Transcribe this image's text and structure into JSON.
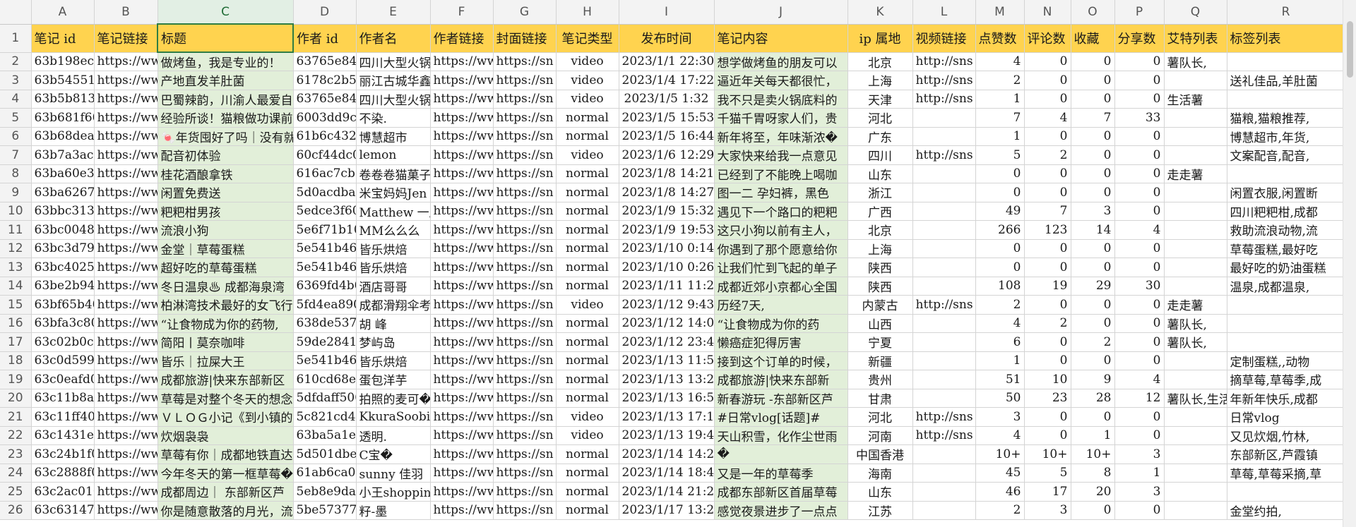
{
  "columns": [
    "A",
    "B",
    "C",
    "D",
    "E",
    "F",
    "G",
    "H",
    "I",
    "J",
    "K",
    "L",
    "M",
    "N",
    "O",
    "P",
    "Q",
    "R"
  ],
  "headers": [
    "笔记 id",
    "笔记链接",
    "标题",
    "作者 id",
    "作者名",
    "作者链接",
    "封面链接",
    "笔记类型",
    "发布时间",
    "笔记内容",
    "ip 属地",
    "视频链接",
    "点赞数",
    "评论数",
    "收藏",
    "分享数",
    "艾特列表",
    "标签列表"
  ],
  "rows": [
    {
      "n": "2",
      "c": [
        "63b198ec00",
        "https://ww",
        "做烤鱼，我是专业的！",
        "63765e8400",
        "四川大型火锅",
        "https://ww",
        "https://sn",
        "video",
        "2023/1/1 22:30",
        "想学做烤鱼的朋友可以",
        "北京",
        "http://sns",
        "4",
        "0",
        "0",
        "0",
        "薯队长,",
        ""
      ]
    },
    {
      "n": "3",
      "c": [
        "63b5455100",
        "https://ww",
        "产地直发羊肚菌",
        "6178c2b500",
        "丽江古城华鑫",
        "https://ww",
        "https://sn",
        "video",
        "2023/1/4 17:22",
        "逼近年关每天都很忙，",
        "上海",
        "http://sns",
        "2",
        "0",
        "0",
        "0",
        "",
        "送礼佳品,羊肚菌"
      ]
    },
    {
      "n": "4",
      "c": [
        "63b5b81300",
        "https://ww",
        "巴蜀辣韵，川渝人最爱自",
        "63765e8400",
        "四川大型火锅",
        "https://ww",
        "https://sn",
        "video",
        "2023/1/5 1:32",
        "我不只是卖火锅底料的",
        "天津",
        "http://sns",
        "1",
        "0",
        "0",
        "0",
        "生活薯",
        ""
      ]
    },
    {
      "n": "5",
      "c": [
        "63b681f600",
        "https://ww",
        "经验所谈！猫粮做功课前",
        "6003dd9c00",
        "不染.",
        "https://ww",
        "https://sn",
        "normal",
        "2023/1/5 15:53",
        "千猫千胃呀家人们，贵",
        "河北",
        "",
        "7",
        "4",
        "7",
        "33",
        "",
        "猫粮,猫粮推荐,"
      ]
    },
    {
      "n": "6",
      "c": [
        "63b68dea00",
        "https://ww",
        "🍬年货囤好了吗｜没有就",
        "61b6c43200",
        "博慧超市",
        "https://ww",
        "https://sn",
        "normal",
        "2023/1/5 16:44",
        "新年将至，年味渐浓�",
        "广东",
        "",
        "1",
        "0",
        "0",
        "0",
        "",
        "博慧超市,年货,"
      ]
    },
    {
      "n": "7",
      "c": [
        "63b7a3ac00",
        "https://ww",
        "配音初体验",
        "60cf44dc00",
        "lemon",
        "https://ww",
        "https://sn",
        "video",
        "2023/1/6 12:29",
        "大家快来给我一点意见",
        "四川",
        "http://sns",
        "5",
        "2",
        "0",
        "0",
        "",
        "文案配音,配音,"
      ]
    },
    {
      "n": "8",
      "c": [
        "63ba60e300",
        "https://ww",
        "桂花酒酿拿铁",
        "616ac7cb00",
        "卷卷卷猫菓子",
        "https://ww",
        "https://sn",
        "normal",
        "2023/1/8 14:21",
        "已经到了不能晚上喝咖",
        "山东",
        "",
        "0",
        "0",
        "0",
        "0",
        "走走薯",
        ""
      ]
    },
    {
      "n": "9",
      "c": [
        "63ba626700",
        "https://ww",
        "闲置免费送",
        "5d0acdba00",
        "米宝妈妈Jen",
        "https://ww",
        "https://sn",
        "normal",
        "2023/1/8 14:27",
        "图一二 孕妇裤，黑色",
        "浙江",
        "",
        "0",
        "0",
        "0",
        "0",
        "",
        "闲置衣服,闲置断"
      ]
    },
    {
      "n": "10",
      "c": [
        "63bbc31300",
        "https://ww",
        "粑粑柑男孩",
        "5edce3f600",
        "Matthew 一廍",
        "https://ww",
        "https://sn",
        "normal",
        "2023/1/9 15:32",
        "遇见下一个路口的粑粑",
        "广西",
        "",
        "49",
        "7",
        "3",
        "0",
        "",
        "四川粑粑柑,成都"
      ]
    },
    {
      "n": "11",
      "c": [
        "63bc004800",
        "https://ww",
        "流浪小狗",
        "5e6f71b100",
        "MM么么么",
        "https://ww",
        "https://sn",
        "normal",
        "2023/1/9 19:53",
        "这只小狗以前有主人，",
        "北京",
        "",
        "266",
        "123",
        "14",
        "4",
        "",
        "救助流浪动物,流"
      ]
    },
    {
      "n": "12",
      "c": [
        "63bc3d7900",
        "https://ww",
        "金堂｜草莓蛋糕",
        "5e541b4600",
        "皆乐烘焙",
        "https://ww",
        "https://sn",
        "normal",
        "2023/1/10 0:14",
        "你遇到了那个愿意给你",
        "上海",
        "",
        "0",
        "0",
        "0",
        "0",
        "",
        "草莓蛋糕,最好吃"
      ]
    },
    {
      "n": "13",
      "c": [
        "63bc402500",
        "https://ww",
        "超好吃的草莓蛋糕",
        "5e541b4600",
        "皆乐烘焙",
        "https://ww",
        "https://sn",
        "normal",
        "2023/1/10 0:26",
        "让我们忙到飞起的单子",
        "陕西",
        "",
        "0",
        "0",
        "0",
        "0",
        "",
        "最好吃的奶油蛋糕"
      ]
    },
    {
      "n": "14",
      "c": [
        "63be2b9400",
        "https://ww",
        "冬日温泉♨ 成都海泉湾",
        "6369fd4b00",
        "酒店哥哥",
        "https://ww",
        "https://sn",
        "normal",
        "2023/1/11 11:23",
        "成都近郊小京都心全国",
        "陕西",
        "",
        "108",
        "19",
        "29",
        "30",
        "",
        "温泉,成都温泉,"
      ]
    },
    {
      "n": "15",
      "c": [
        "63bf65b400",
        "https://ww",
        "柏淋湾技术最好的女飞行",
        "5fd4ea8900",
        "成都滑翔伞考",
        "https://ww",
        "https://sn",
        "video",
        "2023/1/12 9:43",
        "历经7天,",
        "内蒙古",
        "http://sns",
        "2",
        "0",
        "0",
        "0",
        "走走薯",
        ""
      ]
    },
    {
      "n": "16",
      "c": [
        "63bfa3c800",
        "https://ww",
        "“让食物成为你的药物,",
        "638de53700",
        "胡 峰",
        "https://ww",
        "https://sn",
        "normal",
        "2023/1/12 14:08",
        "“让食物成为你的药",
        "山西",
        "",
        "4",
        "2",
        "0",
        "0",
        "薯队长,",
        ""
      ]
    },
    {
      "n": "17",
      "c": [
        "63c02b0c00",
        "https://ww",
        "简阳丨莫奈咖啡",
        "59de2841de",
        "梦屿岛",
        "https://ww",
        "https://sn",
        "normal",
        "2023/1/12 23:45",
        "懒癌症犯得厉害",
        "宁夏",
        "",
        "6",
        "0",
        "2",
        "0",
        "薯队长,",
        ""
      ]
    },
    {
      "n": "18",
      "c": [
        "63c0d59900",
        "https://ww",
        "皆乐｜拉屎大王",
        "5e541b4600",
        "皆乐烘焙",
        "https://ww",
        "https://sn",
        "normal",
        "2023/1/13 11:52",
        "接到这个订单的时候，",
        "新疆",
        "",
        "1",
        "0",
        "0",
        "0",
        "",
        "定制蛋糕,,动物"
      ]
    },
    {
      "n": "19",
      "c": [
        "63c0eafd00",
        "https://ww",
        "成都旅游|快来东部新区",
        "610cd68e00",
        "蛋包洋芋",
        "https://ww",
        "https://sn",
        "normal",
        "2023/1/13 13:24",
        "成都旅游|快来东部新",
        "贵州",
        "",
        "51",
        "10",
        "9",
        "4",
        "",
        "摘草莓,草莓季,成"
      ]
    },
    {
      "n": "20",
      "c": [
        "63c11b8a00",
        "https://ww",
        "草莓是对整个冬天的想念",
        "5dfdaff500",
        "拍照的麦可�",
        "https://ww",
        "https://sn",
        "normal",
        "2023/1/13 16:51",
        "新春游玩 -东部新区芦",
        "甘肃",
        "",
        "50",
        "23",
        "28",
        "12",
        "薯队长,生活",
        "年新年快乐,成都"
      ]
    },
    {
      "n": "21",
      "c": [
        "63c11ff400",
        "https://ww",
        "ＶＬＯＧ小记《到小镇的",
        "5c821cd400",
        "KkuraSoobin",
        "https://ww",
        "https://sn",
        "video",
        "2023/1/13 17:10",
        "#日常vlog[话题]#",
        "河北",
        "http://sns",
        "3",
        "0",
        "0",
        "0",
        "",
        "日常vlog"
      ]
    },
    {
      "n": "22",
      "c": [
        "63c1431e00",
        "https://ww",
        "炊烟袅袅",
        "63ba5a1e00",
        "透明.",
        "https://ww",
        "https://sn",
        "video",
        "2023/1/13 19:40",
        "天山积雪，化作尘世雨",
        "河南",
        "http://sns",
        "4",
        "0",
        "1",
        "0",
        "",
        "又见炊烟,竹林,"
      ]
    },
    {
      "n": "23",
      "c": [
        "63c24b1f00",
        "https://ww",
        "草莓有你｜成都地铁直达",
        "5d501dbe00",
        "C宝�",
        "https://ww",
        "https://sn",
        "normal",
        "2023/1/14 14:26",
        "�",
        "中国香港",
        "",
        "10+",
        "10+",
        "10+",
        "3",
        "",
        "东部新区,芦霞镇"
      ]
    },
    {
      "n": "24",
      "c": [
        "63c2888f00",
        "https://ww",
        "今年冬天的第一框草莓�",
        "61ab6ca000",
        "sunny 佳羽",
        "https://ww",
        "https://sn",
        "normal",
        "2023/1/14 18:48",
        "又是一年的草莓季",
        "海南",
        "",
        "45",
        "5",
        "8",
        "1",
        "",
        "草莓,草莓采摘,草"
      ]
    },
    {
      "n": "25",
      "c": [
        "63c2ac0100",
        "https://ww",
        "成都周边｜ 东部新区芦",
        "5eb8e9da00",
        "小王shoppin",
        "https://ww",
        "https://sn",
        "normal",
        "2023/1/14 21:20",
        "成都东部新区首届草莓",
        "山东",
        "",
        "46",
        "17",
        "20",
        "3",
        "",
        ""
      ]
    },
    {
      "n": "26",
      "c": [
        "63c6314700",
        "https://ww",
        "你是随意散落的月光，流",
        "5be5737795",
        "籽-墨",
        "https://ww",
        "https://sn",
        "normal",
        "2023/1/17 13:25",
        "感觉夜景进步了一点点",
        "江苏",
        "",
        "2",
        "3",
        "0",
        "0",
        "",
        "金堂约拍,"
      ]
    }
  ]
}
